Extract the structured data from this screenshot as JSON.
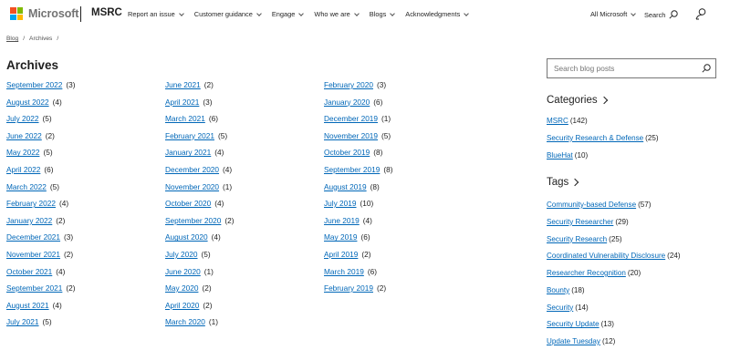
{
  "header": {
    "logo_text": "Microsoft",
    "logo_colors": [
      "#f25022",
      "#7fba00",
      "#00a4ef",
      "#ffb900"
    ],
    "brand": "MSRC",
    "nav": [
      {
        "label": "Report an issue"
      },
      {
        "label": "Customer guidance"
      },
      {
        "label": "Engage"
      },
      {
        "label": "Who we are"
      },
      {
        "label": "Blogs"
      },
      {
        "label": "Acknowledgments"
      }
    ],
    "all_microsoft": "All Microsoft",
    "search_label": "Search"
  },
  "breadcrumb": [
    "Blog",
    "Archives"
  ],
  "title": "Archives",
  "archives": {
    "column1": [
      {
        "month": "September 2022",
        "count": "(3)"
      },
      {
        "month": "August 2022",
        "count": "(4)"
      },
      {
        "month": "July 2022",
        "count": "(5)"
      },
      {
        "month": "June 2022",
        "count": "(2)"
      },
      {
        "month": "May 2022",
        "count": "(5)"
      },
      {
        "month": "April 2022",
        "count": "(6)"
      },
      {
        "month": "March 2022",
        "count": "(5)"
      },
      {
        "month": "February 2022",
        "count": "(4)"
      },
      {
        "month": "January 2022",
        "count": "(2)"
      },
      {
        "month": "December 2021",
        "count": "(3)"
      },
      {
        "month": "November 2021",
        "count": "(2)"
      },
      {
        "month": "October 2021",
        "count": "(4)"
      },
      {
        "month": "September 2021",
        "count": "(2)"
      },
      {
        "month": "August 2021",
        "count": "(4)"
      },
      {
        "month": "July 2021",
        "count": "(5)"
      }
    ],
    "column2": [
      {
        "month": "June 2021",
        "count": "(2)"
      },
      {
        "month": "April 2021",
        "count": "(3)"
      },
      {
        "month": "March 2021",
        "count": "(6)"
      },
      {
        "month": "February 2021",
        "count": "(5)"
      },
      {
        "month": "January 2021",
        "count": "(4)"
      },
      {
        "month": "December 2020",
        "count": "(4)"
      },
      {
        "month": "November 2020",
        "count": "(1)"
      },
      {
        "month": "October 2020",
        "count": "(4)"
      },
      {
        "month": "September 2020",
        "count": "(2)"
      },
      {
        "month": "August 2020",
        "count": "(4)"
      },
      {
        "month": "July 2020",
        "count": "(5)"
      },
      {
        "month": "June 2020",
        "count": "(1)"
      },
      {
        "month": "May 2020",
        "count": "(2)"
      },
      {
        "month": "April 2020",
        "count": "(2)"
      },
      {
        "month": "March 2020",
        "count": "(1)"
      }
    ],
    "column3": [
      {
        "month": "February 2020",
        "count": "(3)"
      },
      {
        "month": "January 2020",
        "count": "(6)"
      },
      {
        "month": "December 2019",
        "count": "(1)"
      },
      {
        "month": "November 2019",
        "count": "(5)"
      },
      {
        "month": "October 2019",
        "count": "(8)"
      },
      {
        "month": "September 2019",
        "count": "(8)"
      },
      {
        "month": "August 2019",
        "count": "(8)"
      },
      {
        "month": "July 2019",
        "count": "(10)"
      },
      {
        "month": "June 2019",
        "count": "(4)"
      },
      {
        "month": "May 2019",
        "count": "(6)"
      },
      {
        "month": "April 2019",
        "count": "(2)"
      },
      {
        "month": "March 2019",
        "count": "(6)"
      },
      {
        "month": "February 2019",
        "count": "(2)"
      }
    ]
  },
  "sidebar": {
    "search_placeholder": "Search blog posts",
    "categories_title": "Categories",
    "categories": [
      {
        "name": "MSRC",
        "count": "(142)"
      },
      {
        "name": "Security Research & Defense",
        "count": "(25)"
      },
      {
        "name": "BlueHat",
        "count": "(10)"
      }
    ],
    "tags_title": "Tags",
    "tags": [
      {
        "name": "Community-based Defense",
        "count": "(57)"
      },
      {
        "name": "Security Researcher",
        "count": "(29)"
      },
      {
        "name": "Security Research",
        "count": "(25)"
      },
      {
        "name": "Coordinated Vulnerability Disclosure",
        "count": "(24)"
      },
      {
        "name": "Researcher Recognition",
        "count": "(20)"
      },
      {
        "name": "Bounty",
        "count": "(18)"
      },
      {
        "name": "Security",
        "count": "(14)"
      },
      {
        "name": "Security Update",
        "count": "(13)"
      },
      {
        "name": "Update Tuesday",
        "count": "(12)"
      }
    ]
  },
  "colors": {
    "link": "#0067b8",
    "text": "#1f1f1f"
  }
}
